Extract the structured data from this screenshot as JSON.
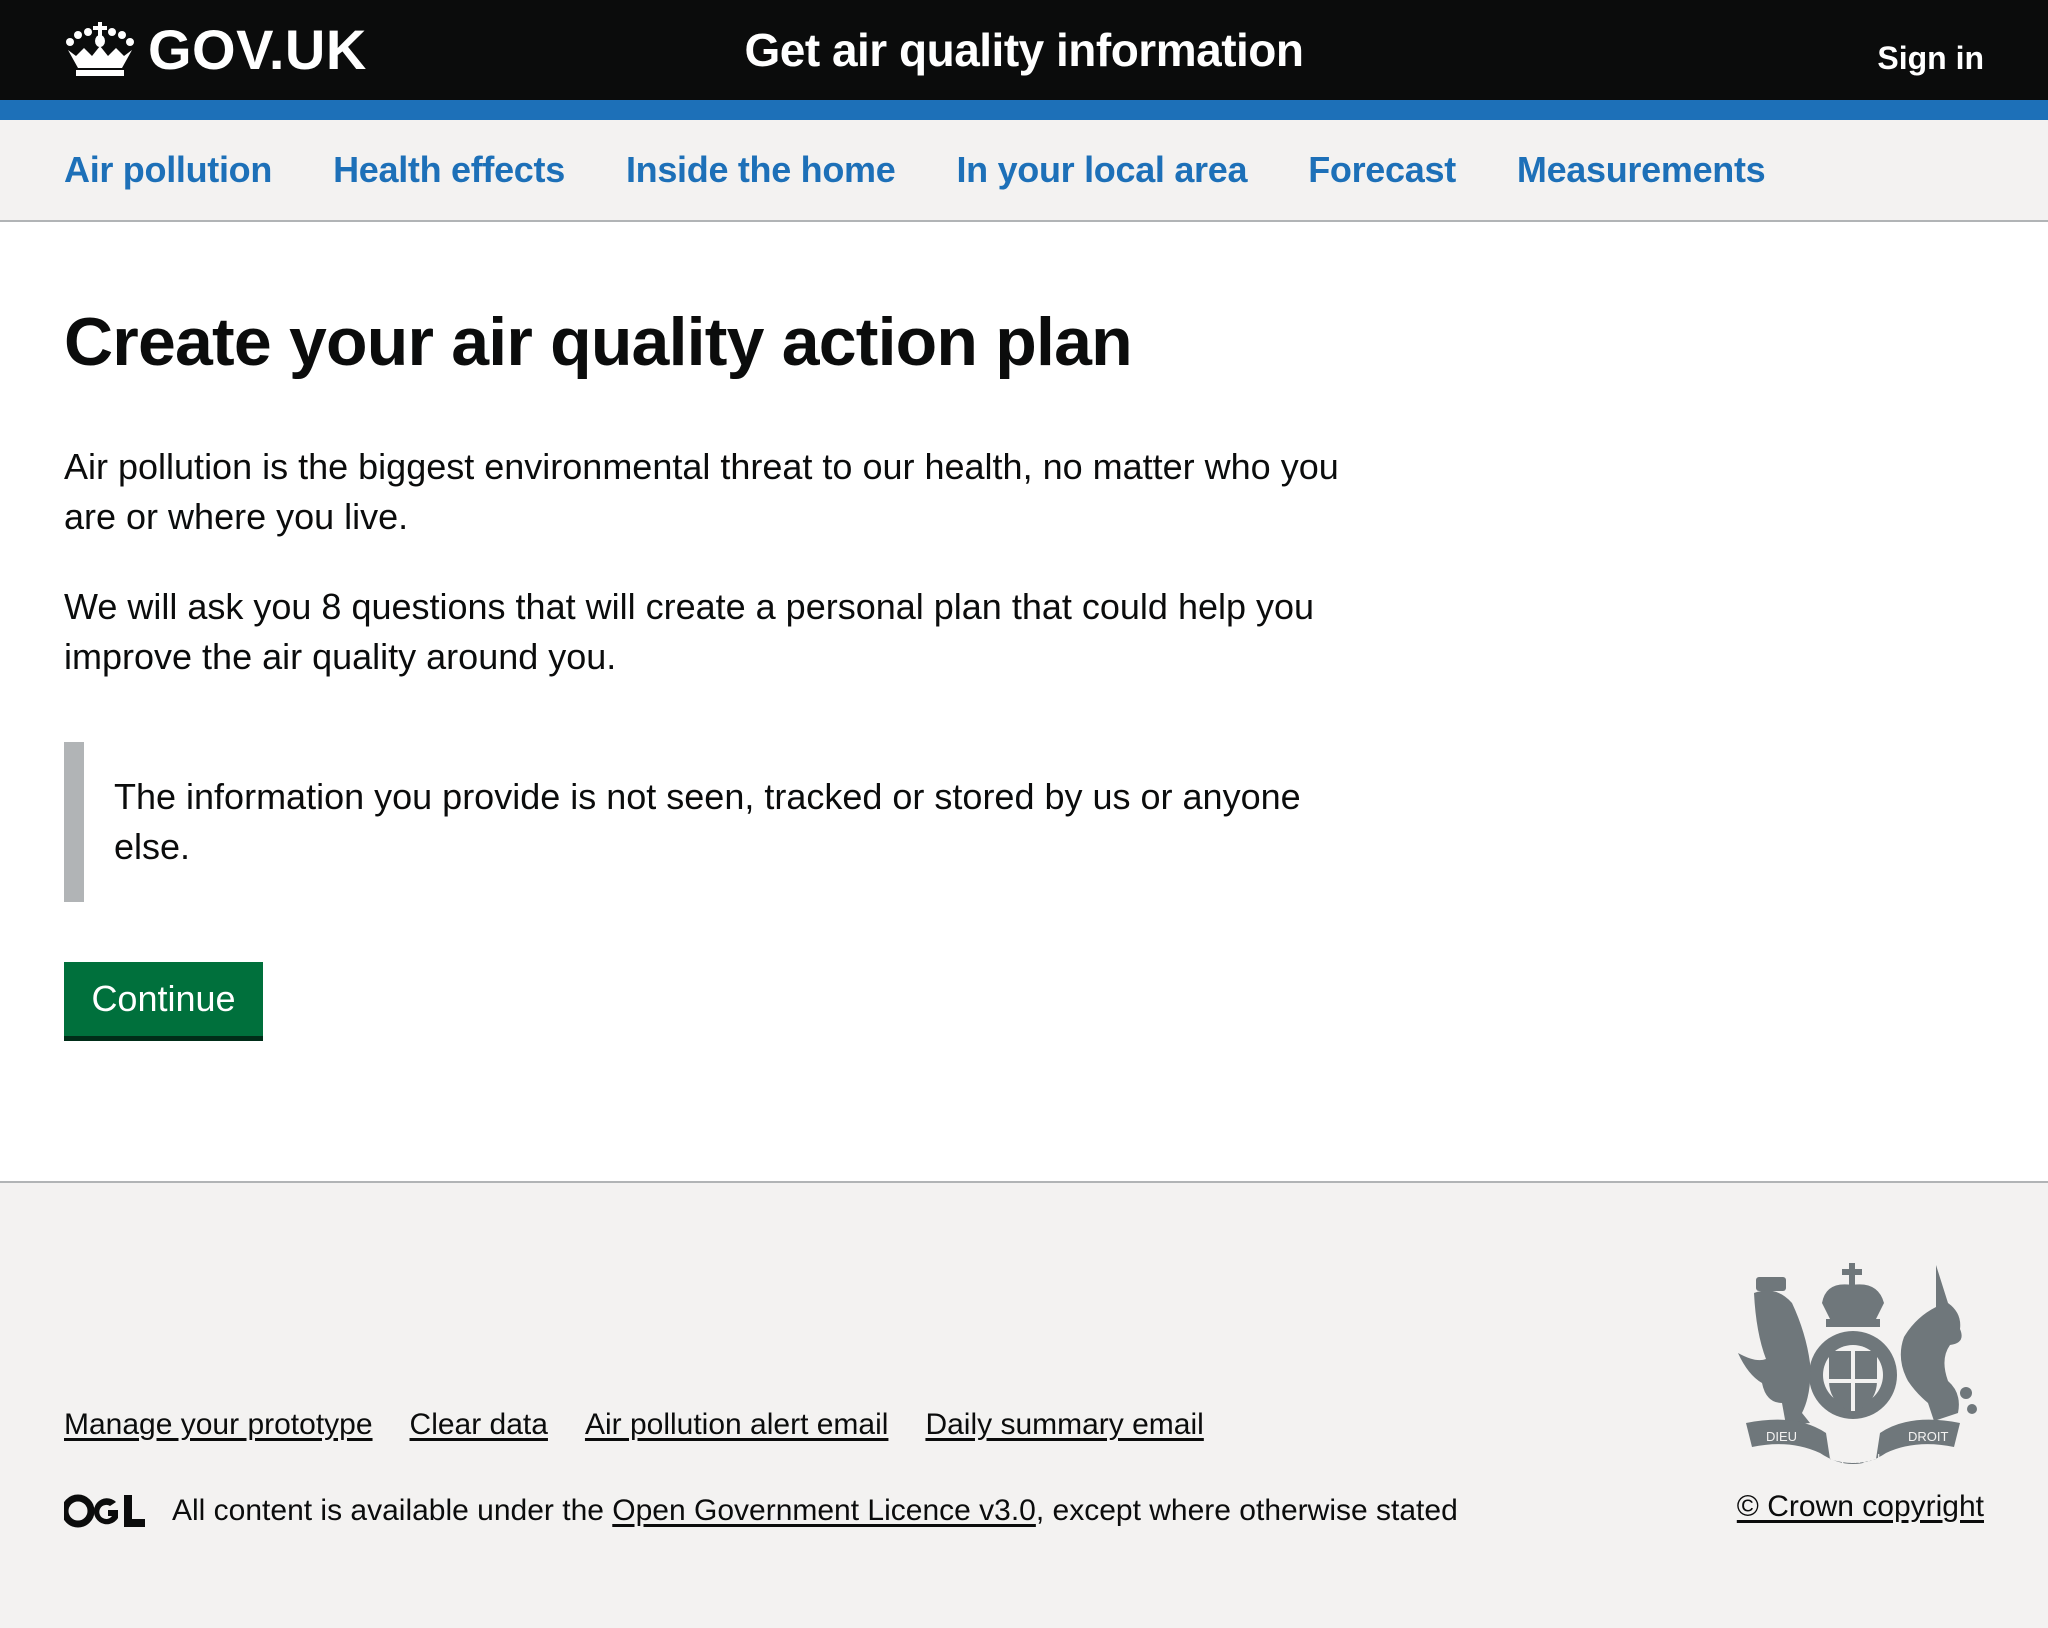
{
  "header": {
    "logo_text": "GOV.UK",
    "service_name": "Get air quality information",
    "sign_in": "Sign in",
    "colors": {
      "background": "#0b0c0c",
      "stripe": "#1d70b8"
    }
  },
  "nav": {
    "items": [
      {
        "label": "Air pollution"
      },
      {
        "label": "Health effects"
      },
      {
        "label": "Inside the home"
      },
      {
        "label": "In your local area"
      },
      {
        "label": "Forecast"
      },
      {
        "label": "Measurements"
      }
    ],
    "link_color": "#1d70b8"
  },
  "main": {
    "title": "Create your air quality action plan",
    "paragraphs": [
      "Air pollution is the biggest environmental threat to our health, no matter who you are or where you live.",
      "We will ask you 8 questions that will create a personal plan that could help you improve the air quality around you."
    ],
    "inset_text": "The information you provide is not seen, tracked or stored by us or anyone else.",
    "continue_button": "Continue",
    "button_color": "#00703c"
  },
  "footer": {
    "links": [
      {
        "label": "Manage your prototype"
      },
      {
        "label": "Clear data"
      },
      {
        "label": "Air pollution alert email"
      },
      {
        "label": "Daily summary email"
      }
    ],
    "licence_prefix": "All content is available under the ",
    "licence_link": "Open Government Licence v3.0",
    "licence_suffix": ", except where otherwise stated",
    "copyright": "© Crown copyright",
    "icons": {
      "ogl": "ogl-logo-icon",
      "crest": "royal-coat-of-arms-icon",
      "crown": "crown-icon"
    }
  }
}
